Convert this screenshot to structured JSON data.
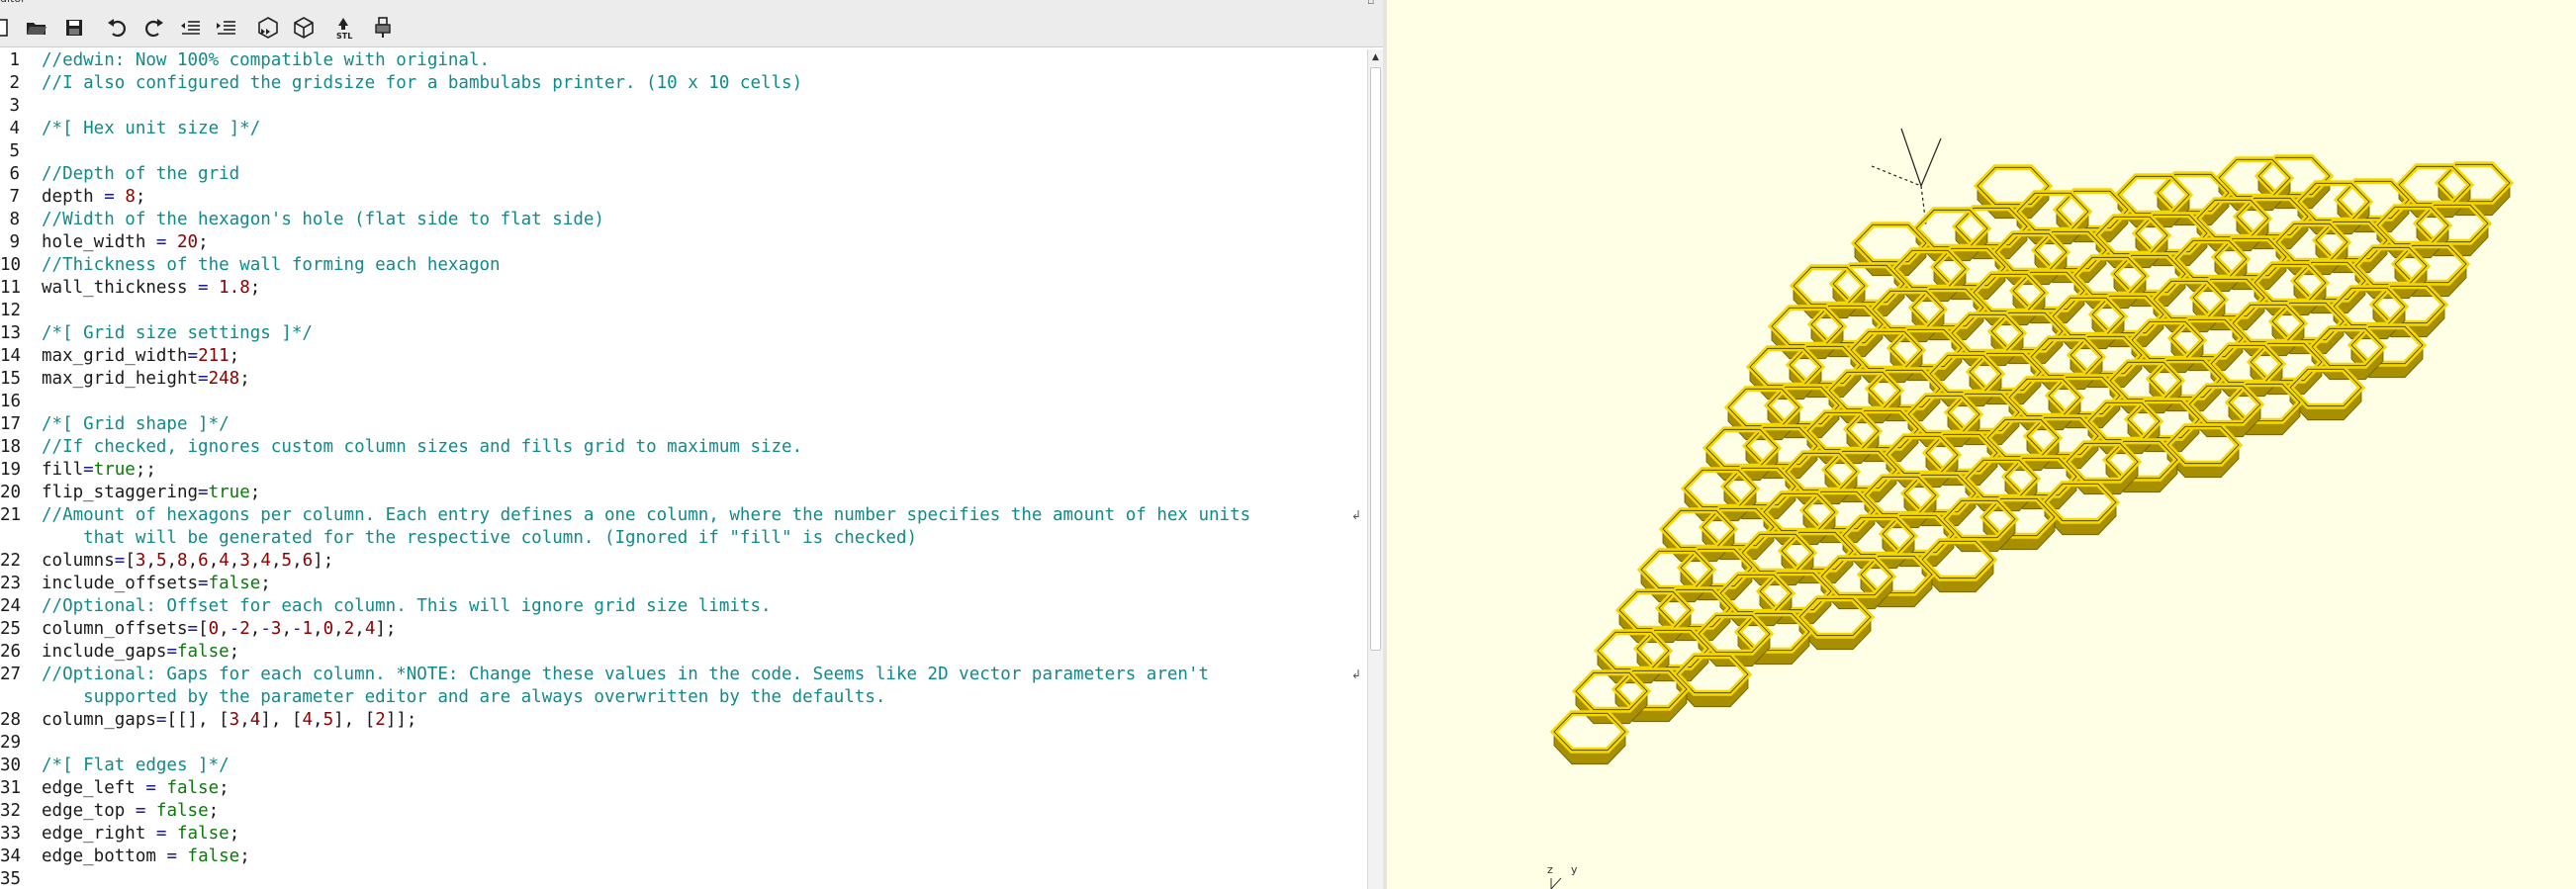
{
  "window": {
    "title_fragment": "ditor"
  },
  "toolbar": {
    "buttons": [
      {
        "name": "new-file",
        "icon": "new-file-icon"
      },
      {
        "name": "open-file",
        "icon": "folder-open-icon"
      },
      {
        "name": "save-file",
        "icon": "save-icon"
      },
      {
        "name": "undo",
        "icon": "undo-icon"
      },
      {
        "name": "redo",
        "icon": "redo-icon"
      },
      {
        "name": "unindent",
        "icon": "unindent-icon"
      },
      {
        "name": "indent",
        "icon": "indent-icon"
      },
      {
        "name": "preview",
        "icon": "preview-icon"
      },
      {
        "name": "render",
        "icon": "render-icon"
      },
      {
        "name": "export-stl",
        "icon": "stl-export-icon",
        "label": "STL"
      },
      {
        "name": "send-to-printer",
        "icon": "printer-icon"
      }
    ]
  },
  "editor": {
    "lines": [
      {
        "n": "1",
        "t": "//edwin: Now 100% compatible with original."
      },
      {
        "n": "2",
        "t": "//I also configured the gridsize for a bambulabs printer. (10 x 10 cells)"
      },
      {
        "n": "3",
        "t": ""
      },
      {
        "n": "4",
        "t": "/*[ Hex unit size ]*/"
      },
      {
        "n": "5",
        "t": ""
      },
      {
        "n": "6",
        "t": "//Depth of the grid"
      },
      {
        "n": "7",
        "t": "depth = 8;"
      },
      {
        "n": "8",
        "t": "//Width of the hexagon's hole (flat side to flat side)"
      },
      {
        "n": "9",
        "t": "hole_width = 20;"
      },
      {
        "n": "10",
        "t": "//Thickness of the wall forming each hexagon"
      },
      {
        "n": "11",
        "t": "wall_thickness = 1.8;"
      },
      {
        "n": "12",
        "t": ""
      },
      {
        "n": "13",
        "t": "/*[ Grid size settings ]*/"
      },
      {
        "n": "14",
        "t": "max_grid_width=211;"
      },
      {
        "n": "15",
        "t": "max_grid_height=248;"
      },
      {
        "n": "16",
        "t": ""
      },
      {
        "n": "17",
        "t": "/*[ Grid shape ]*/"
      },
      {
        "n": "18",
        "t": "//If checked, ignores custom column sizes and fills grid to maximum size."
      },
      {
        "n": "19",
        "t": "fill=true;;"
      },
      {
        "n": "20",
        "t": "flip_staggering=true;"
      },
      {
        "n": "21",
        "t": "//Amount of hexagons per column. Each entry defines a one column, where the number specifies the amount of hex units"
      },
      {
        "n": "",
        "t": "    that will be generated for the respective column. (Ignored if \"fill\" is checked)"
      },
      {
        "n": "22",
        "t": "columns=[3,5,8,6,4,3,4,5,6];"
      },
      {
        "n": "23",
        "t": "include_offsets=false;"
      },
      {
        "n": "24",
        "t": "//Optional: Offset for each column. This will ignore grid size limits."
      },
      {
        "n": "25",
        "t": "column_offsets=[0,-2,-3,-1,0,2,4];"
      },
      {
        "n": "26",
        "t": "include_gaps=false;"
      },
      {
        "n": "27",
        "t": "//Optional: Gaps for each column. *NOTE: Change these values in the code. Seems like 2D vector parameters aren't"
      },
      {
        "n": "",
        "t": "    supported by the parameter editor and are always overwritten by the defaults."
      },
      {
        "n": "28",
        "t": "column_gaps=[[], [3,4], [4,5], [2]];"
      },
      {
        "n": "29",
        "t": ""
      },
      {
        "n": "30",
        "t": "/*[ Flat edges ]*/"
      },
      {
        "n": "31",
        "t": "edge_left = false;"
      },
      {
        "n": "32",
        "t": "edge_top = false;"
      },
      {
        "n": "33",
        "t": "edge_right = false;"
      },
      {
        "n": "34",
        "t": "edge_bottom = false;"
      },
      {
        "n": "35",
        "t": ""
      }
    ]
  },
  "viewport": {
    "background": "#ffffe5",
    "model_color": "#f5d800",
    "axis_labels": {
      "z": "z",
      "y": "y"
    }
  },
  "colors": {
    "comment": "#118a8a",
    "number": "#8b0000",
    "keyword": "#0a7a0a"
  }
}
